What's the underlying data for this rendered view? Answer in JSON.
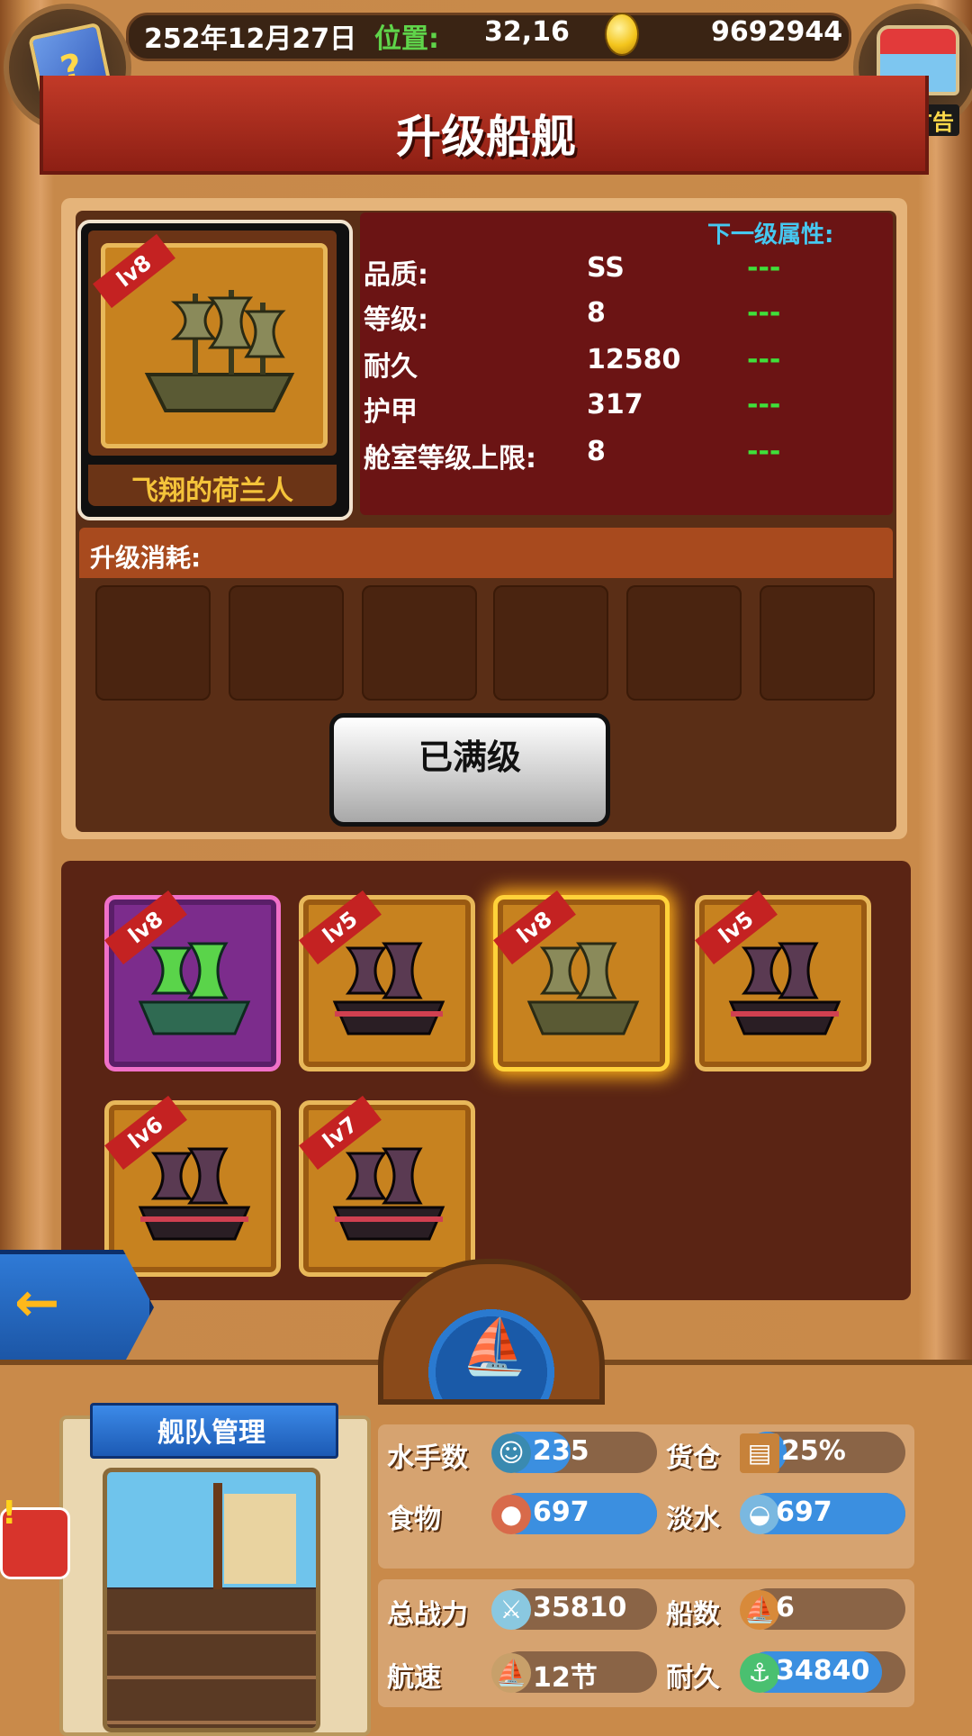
{
  "header": {
    "date": "252年12月27日",
    "position_label": "位置:",
    "position_value": "32,16",
    "gold": "9692944",
    "ad_label": "有新广告",
    "book_icon": "?"
  },
  "title": "升级船舰",
  "selected_ship": {
    "name": "飞翔的荷兰人",
    "level_tag": "lv8"
  },
  "attributes": {
    "next_label": "下一级属性:",
    "rows": [
      {
        "label": "品质:",
        "value": "SS",
        "next": "---"
      },
      {
        "label": "等级:",
        "value": "8",
        "next": "---"
      },
      {
        "label": "耐久",
        "value": "12580",
        "next": "---"
      },
      {
        "label": "护甲",
        "value": "317",
        "next": "---"
      },
      {
        "label": "舱室等级上限:",
        "value": "8",
        "next": "---"
      }
    ]
  },
  "upgrade_cost": {
    "label": "升级消耗:"
  },
  "max_button": "已满级",
  "fleet_ships": [
    {
      "level": "lv8",
      "style": "purple-green"
    },
    {
      "level": "lv5",
      "style": "red-black"
    },
    {
      "level": "lv8",
      "style": "gold",
      "selected": true
    },
    {
      "level": "lv5",
      "style": "red-black"
    },
    {
      "level": "lv6",
      "style": "red-black"
    },
    {
      "level": "lv7",
      "style": "red-black"
    }
  ],
  "fleet_panel": {
    "title": "舰队管理"
  },
  "stats": {
    "sailors_label": "水手数",
    "sailors": "235",
    "cargo_label": "货仓",
    "cargo": "25%",
    "food_label": "食物",
    "food": "697",
    "water_label": "淡水",
    "water": "697",
    "power_label": "总战力",
    "power": "35810",
    "ships_label": "船数",
    "ships": "6",
    "speed_label": "航速",
    "speed": "12节",
    "durability_label": "耐久",
    "durability": "34840"
  },
  "colors": {
    "title_red": "#c23a28",
    "next_blue": "#46c8f0",
    "next_green": "#3fe03a",
    "bar_blue": "#3b8fe0"
  }
}
